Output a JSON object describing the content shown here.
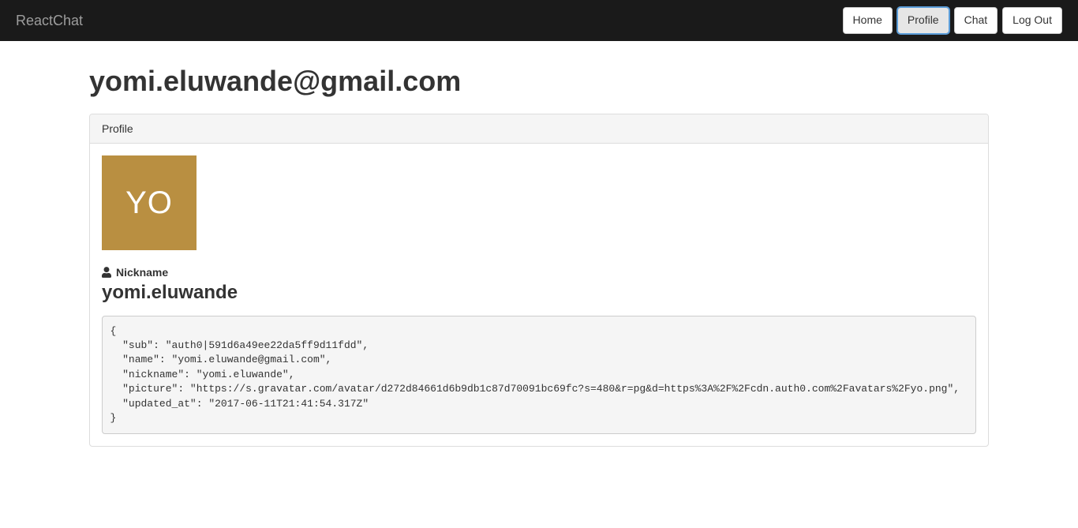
{
  "navbar": {
    "brand": "ReactChat",
    "buttons": {
      "home": "Home",
      "profile": "Profile",
      "chat": "Chat",
      "logout": "Log Out"
    }
  },
  "page": {
    "title": "yomi.eluwande@gmail.com"
  },
  "panel": {
    "heading": "Profile",
    "avatar_initials": "YO",
    "nickname_label": "Nickname",
    "nickname_value": "yomi.eluwande",
    "json_dump": "{\n  \"sub\": \"auth0|591d6a49ee22da5ff9d11fdd\",\n  \"name\": \"yomi.eluwande@gmail.com\",\n  \"nickname\": \"yomi.eluwande\",\n  \"picture\": \"https://s.gravatar.com/avatar/d272d84661d6b9db1c87d70091bc69fc?s=480&r=pg&d=https%3A%2F%2Fcdn.auth0.com%2Favatars%2Fyo.png\",\n  \"updated_at\": \"2017-06-11T21:41:54.317Z\"\n}"
  }
}
